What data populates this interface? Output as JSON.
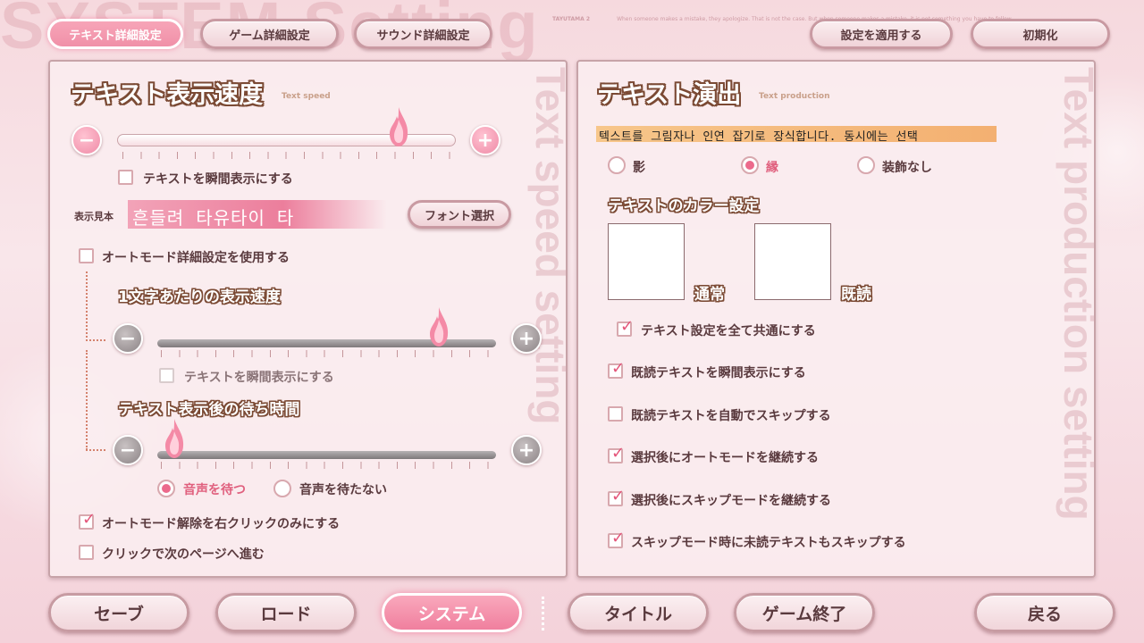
{
  "header": {
    "watermark": "SYSTEM Setting",
    "tagline": [
      "TAYUTAMA 2",
      "When someone makes a mistake, they apologize. That is not the case. But when someone makes a mistake, it is not something you have to follow..."
    ],
    "tabs": [
      {
        "label": "テキスト詳細設定",
        "active": true
      },
      {
        "label": "ゲーム詳細設定",
        "active": false
      },
      {
        "label": "サウンド詳細設定",
        "active": false
      }
    ],
    "apply_label": "設定を適用する",
    "reset_label": "初期化"
  },
  "left": {
    "vertical_watermark": "Text speed setting",
    "title": "テキスト表示速度",
    "subtitle": "Text speed",
    "speed_slider": {
      "value_percent": 83
    },
    "instant_label": "テキストを瞬間表示にする",
    "instant_checked": false,
    "sample_label": "表示見本",
    "sample_text": "흔들려 타유타이 타",
    "font_button": "フォント選択",
    "auto_detail_label": "オートモード詳細設定を使用する",
    "auto_detail_checked": false,
    "per_char_title": "1文字あたりの表示速度",
    "per_char_slider": {
      "value_percent": 83
    },
    "auto_instant_label": "テキストを瞬間表示にする",
    "wait_title": "テキスト表示後の待ち時間",
    "wait_slider": {
      "value_percent": 5
    },
    "wait_voice_label": "音声を待つ",
    "no_wait_voice_label": "音声を待たない",
    "right_click_label": "オートモード解除を右クリックのみにする",
    "right_click_checked": true,
    "click_next_label": "クリックで次のページへ進む",
    "click_next_checked": false
  },
  "right": {
    "vertical_watermark": "Text production setting",
    "title": "テキスト演出",
    "subtitle": "Text production",
    "description": "텍스트를 그림자나 인연 잡기로 장식합니다. 동시에는 선택",
    "radio_options": [
      {
        "label": "影",
        "selected": false
      },
      {
        "label": "縁",
        "selected": true
      },
      {
        "label": "装飾なし",
        "selected": false
      }
    ],
    "color_title": "テキストのカラー設定",
    "color_normal_label": "通常",
    "color_read_label": "既読",
    "color_normal": "#ffffff",
    "color_read": "#ffffff",
    "options": [
      {
        "label": "テキスト設定を全て共通にする",
        "checked": true
      },
      {
        "label": "既読テキストを瞬間表示にする",
        "checked": true
      },
      {
        "label": "既読テキストを自動でスキップする",
        "checked": false
      },
      {
        "label": "選択後にオートモードを継続する",
        "checked": true
      },
      {
        "label": "選択後にスキップモードを継続する",
        "checked": true
      },
      {
        "label": "スキップモード時に未読テキストもスキップする",
        "checked": true
      }
    ]
  },
  "nav": {
    "save": "セーブ",
    "load": "ロード",
    "system": "システム",
    "title": "タイトル",
    "quit": "ゲーム終了",
    "back": "戻る"
  },
  "colors": {
    "accent_pink": "#ec6a8c",
    "heading_outline": "#7b4a34",
    "panel_bg": "#faeef0"
  }
}
